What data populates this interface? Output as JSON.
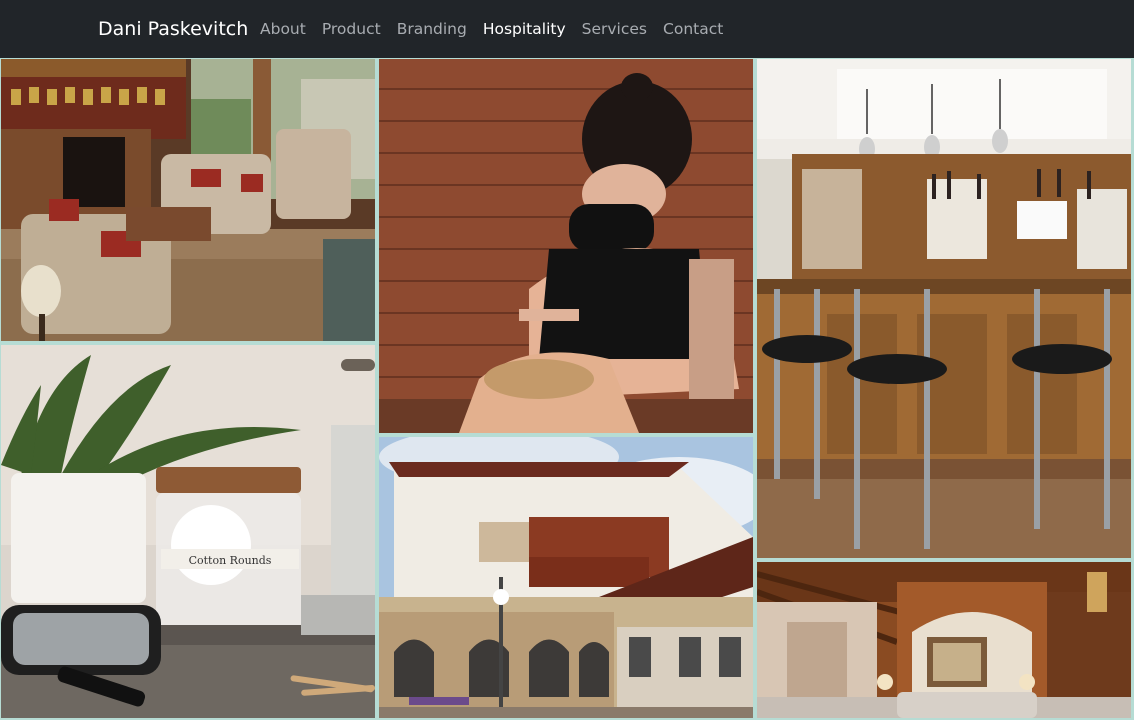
{
  "navbar": {
    "brand": "Dani Paskevitch",
    "links": [
      {
        "label": "About",
        "active": false
      },
      {
        "label": "Product",
        "active": false
      },
      {
        "label": "Branding",
        "active": false
      },
      {
        "label": "Hospitality",
        "active": true
      },
      {
        "label": "Services",
        "active": false
      },
      {
        "label": "Contact",
        "active": false
      }
    ]
  },
  "gallery": {
    "photos": [
      {
        "id": "lobby-sitting-room",
        "caption": ""
      },
      {
        "id": "lash-technician",
        "caption": ""
      },
      {
        "id": "hotel-bar-stools",
        "caption": ""
      },
      {
        "id": "cotton-rounds-spa-table",
        "caption": "",
        "jar_label": "Cotton Rounds"
      },
      {
        "id": "bavarian-hotel-exterior",
        "caption": ""
      },
      {
        "id": "hotel-lobby-fireplace",
        "caption": ""
      }
    ]
  },
  "colors": {
    "navbar_bg": "#212529",
    "gutter": "#b6dcd4",
    "brand": "#ffffff",
    "link_muted": "#a8acb1",
    "link_active": "#ffffff"
  }
}
